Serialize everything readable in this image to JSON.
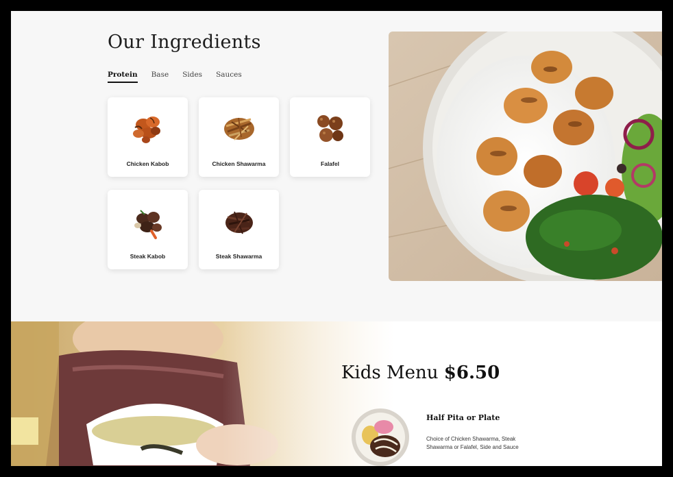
{
  "ingredients": {
    "title": "Our Ingredients",
    "tabs": [
      {
        "label": "Protein",
        "active": true
      },
      {
        "label": "Base",
        "active": false
      },
      {
        "label": "Sides",
        "active": false
      },
      {
        "label": "Sauces",
        "active": false
      }
    ],
    "items": [
      {
        "label": "Chicken Kabob",
        "icon": "chicken-kabob-icon"
      },
      {
        "label": "Chicken Shawarma",
        "icon": "chicken-shawarma-icon"
      },
      {
        "label": "Falafel",
        "icon": "falafel-icon"
      },
      {
        "label": "Steak Kabob",
        "icon": "steak-kabob-icon"
      },
      {
        "label": "Steak Shawarma",
        "icon": "steak-shawarma-icon"
      }
    ]
  },
  "kids_menu": {
    "title": "Kids Menu",
    "price": "$6.50",
    "item_name": "Half Pita or Plate",
    "item_description": "Choice of Chicken Shawarma, Steak Shawarma or Falafel, Side and Sauce"
  },
  "colors": {
    "background": "#f7f7f7",
    "frame": "#000000",
    "text_dark": "#111111",
    "card": "#ffffff"
  }
}
